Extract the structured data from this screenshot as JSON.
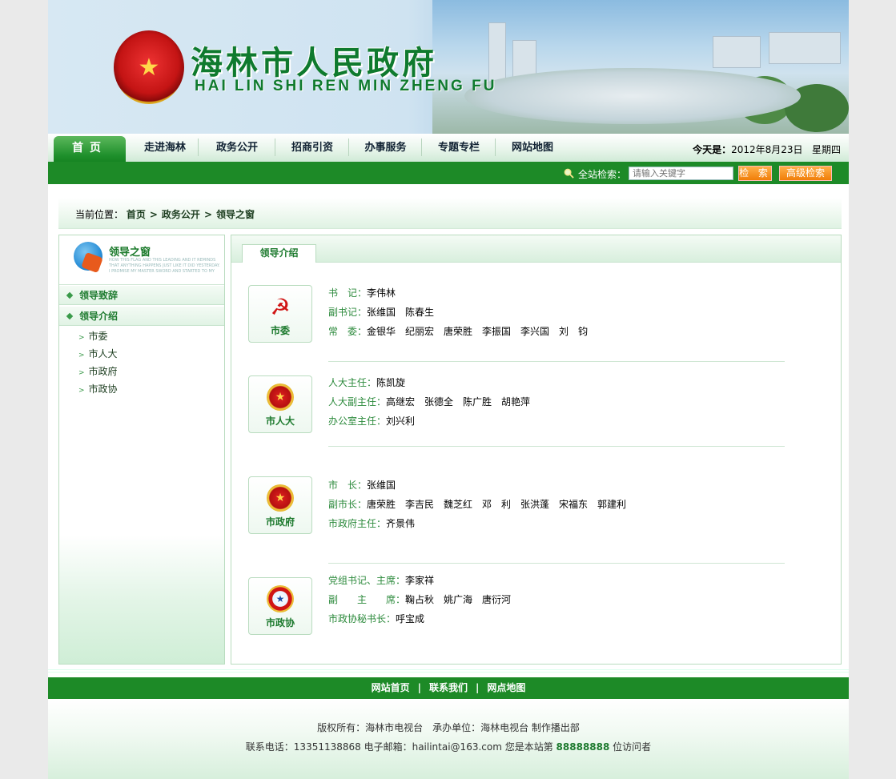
{
  "banner": {
    "title": "海林市人民政府",
    "title_en": "HAI LIN SHI REN MIN ZHENG FU",
    "emblem_icon": "national-emblem-icon"
  },
  "nav": {
    "items": [
      "首页",
      "走进海林",
      "政务公开",
      "招商引资",
      "办事服务",
      "专题专栏",
      "网站地图"
    ],
    "date_label": "今天是：",
    "date_value": "2012年8月23日",
    "weekday": "星期四"
  },
  "search": {
    "label": "全站检索：",
    "placeholder": "请输入关键字",
    "search_button": "检 索",
    "advanced_button": "高级检索"
  },
  "breadcrumb": {
    "label": "当前位置：",
    "items": [
      "首页",
      "政务公开",
      "领导之窗"
    ]
  },
  "sidebar": {
    "title": "领导之窗",
    "subtitle": "HOW THIS FLAG AND THIS LEADING AND IT REMINDS THAT ANYTHING HAPPENS JUST LIKE IT DID YESTERDAY. I PROMISE MY MASTER SWORD AND STARTED TO MY CAREER IN A NEW TECH",
    "menu": [
      "领导致辞",
      "领导介绍"
    ],
    "sub_items": [
      "市委",
      "市人大",
      "市政府",
      "市政协"
    ]
  },
  "content": {
    "tab_label": "领导介绍",
    "groups": [
      {
        "label": "市委",
        "icon": "party-emblem-icon",
        "rows": [
          {
            "k": "书　记：",
            "v": "李伟林"
          },
          {
            "k": "副书记：",
            "v": "张维国　陈春生"
          },
          {
            "k": "常　委：",
            "v": "金银华　纪丽宏　唐荣胜　李振国　李兴国　刘　钧"
          }
        ]
      },
      {
        "label": "市人大",
        "icon": "national-emblem-icon",
        "rows": [
          {
            "k": "人大主任：",
            "v": "陈凯旋"
          },
          {
            "k": "人大副主任：",
            "v": "高继宏　张德全　陈广胜　胡艳萍"
          },
          {
            "k": "办公室主任：",
            "v": "刘兴利"
          }
        ]
      },
      {
        "label": "市政府",
        "icon": "national-emblem-icon",
        "rows": [
          {
            "k": "市　长：",
            "v": "张维国"
          },
          {
            "k": "副市长：",
            "v": "唐荣胜　李吉民　魏芝红　邓　利　张洪蓬　宋福东　郭建利"
          },
          {
            "k": "市政府主任：",
            "v": "齐景伟"
          }
        ]
      },
      {
        "label": "市政协",
        "icon": "cppcc-emblem-icon",
        "rows": [
          {
            "k": "党组书记、主席：",
            "v": "李家祥"
          },
          {
            "k": "副　　主　　席：",
            "v": "鞠占秋　姚广海　唐衍河"
          },
          {
            "k": "市政协秘书长：",
            "v": "呼宝成"
          }
        ]
      }
    ]
  },
  "footer": {
    "links": [
      "网站首页",
      "联系我们",
      "网点地图"
    ],
    "line1": "版权所有：海林市电视台　承办单位：海林电视台 制作播出部",
    "line2_prefix": "联系电话：13351138868 电子邮箱：hailintai@163.com 您是本站第",
    "visits": "88888888",
    "line2_suffix": "位访问者"
  }
}
